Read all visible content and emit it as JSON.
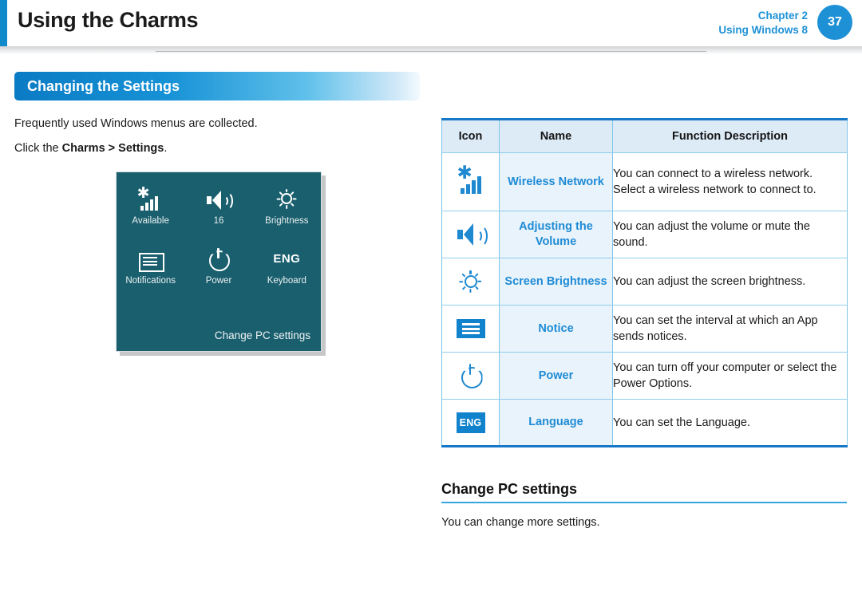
{
  "header": {
    "title": "Using the Charms",
    "chapter_line1": "Chapter 2",
    "chapter_line2": "Using Windows 8",
    "page_number": "37"
  },
  "left": {
    "section_title": "Changing the Settings",
    "intro_text": "Frequently used Windows menus are collected.",
    "instruction_prefix": "Click the ",
    "instruction_bold": "Charms > Settings",
    "instruction_suffix": ".",
    "charms_panel": {
      "items": [
        {
          "icon": "wireless-signal-icon",
          "label": "Available"
        },
        {
          "icon": "speaker-volume-icon",
          "label": "16"
        },
        {
          "icon": "brightness-sun-icon",
          "label": "Brightness"
        },
        {
          "icon": "notifications-icon",
          "label": "Notifications"
        },
        {
          "icon": "power-icon",
          "label": "Power"
        },
        {
          "icon": "keyboard-language-icon",
          "label": "Keyboard"
        }
      ],
      "eng_badge": "ENG",
      "footer_link": "Change PC settings"
    }
  },
  "table": {
    "headers": [
      "Icon",
      "Name",
      "Function Description"
    ],
    "rows": [
      {
        "icon": "wireless-signal-icon",
        "name": "Wireless Network",
        "description": "You can connect to a wireless network. Select a wireless network to connect to."
      },
      {
        "icon": "speaker-volume-icon",
        "name": "Adjusting the Volume",
        "description": "You can adjust the volume or mute the sound."
      },
      {
        "icon": "brightness-sun-icon",
        "name": "Screen Brightness",
        "description": "You can adjust the screen brightness."
      },
      {
        "icon": "notifications-icon",
        "name": "Notice",
        "description": "You can set the interval at which an App sends notices."
      },
      {
        "icon": "power-icon",
        "name": "Power",
        "description": "You can turn off your computer or select the Power Options."
      },
      {
        "icon": "language-eng-icon",
        "name": "Language",
        "description": "You can set the Language.",
        "icon_text": "ENG"
      }
    ]
  },
  "sub_section": {
    "title": "Change PC settings",
    "body": "You can change more settings."
  },
  "colors": {
    "accent_blue": "#1E91D6",
    "link_blue": "#1E8BD5",
    "table_border": "#1878C8",
    "name_cell_bg": "#E9F3FB",
    "panel_teal": "#1A5F6E"
  }
}
